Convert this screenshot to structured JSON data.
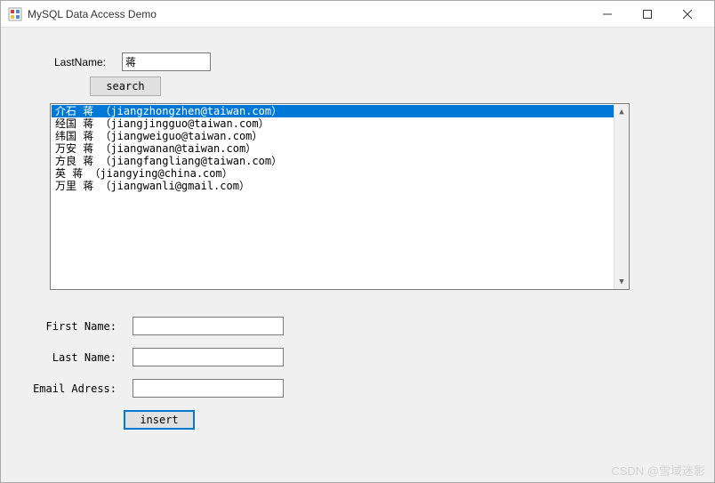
{
  "window": {
    "title": "MySQL Data Access Demo"
  },
  "search": {
    "lastname_label": "LastName:",
    "lastname_value": "蒋",
    "search_button": "search"
  },
  "results": {
    "selected_index": 0,
    "items": [
      "介石 蒋 （jiangzhongzhen@taiwan.com）",
      "经国 蒋 （jiangjingguo@taiwan.com）",
      "纬国 蒋 （jiangweiguo@taiwan.com）",
      "万安 蒋 （jiangwanan@taiwan.com）",
      "方良 蒋 （jiangfangliang@taiwan.com）",
      "英 蒋 （jiangying@china.com）",
      "万里 蒋 （jiangwanli@gmail.com）"
    ]
  },
  "form": {
    "first_name_label": "First Name:",
    "first_name_value": "",
    "last_name_label": "Last Name:",
    "last_name_value": "",
    "email_label": "Email Adress:",
    "email_value": "",
    "insert_button": "insert"
  },
  "watermark": "CSDN @雪域迷影"
}
